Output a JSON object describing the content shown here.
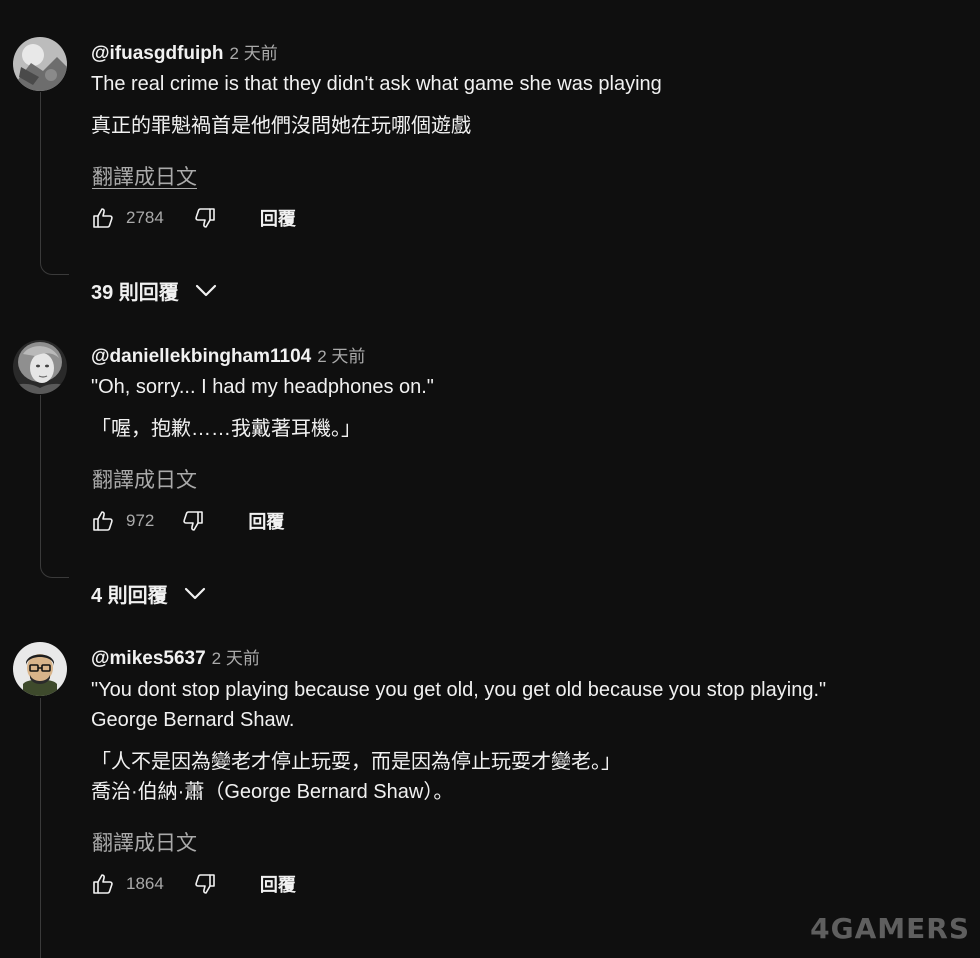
{
  "comments": [
    {
      "handle": "@ifuasgdfuiph",
      "time": "2 天前",
      "text_en": "The real crime is that they didn't  ask what game she was playing",
      "text_zh": "真正的罪魁禍首是他們沒問她在玩哪個遊戲",
      "translate_label": "翻譯成日文",
      "likes": "2784",
      "reply_label": "回覆",
      "replies_label": "39 則回覆"
    },
    {
      "handle": "@daniellekbingham1104",
      "time": "2 天前",
      "text_en": "\"Oh, sorry... I had my headphones on.\"",
      "text_zh": "「喔，抱歉……我戴著耳機。」",
      "translate_label": "翻譯成日文",
      "likes": "972",
      "reply_label": "回覆",
      "replies_label": "4 則回覆"
    },
    {
      "handle": "@mikes5637",
      "time": "2 天前",
      "text_en_line1": "\"You dont stop playing because you get old, you get old because you stop playing.\"",
      "text_en_line2": "George Bernard Shaw.",
      "text_zh_line1": "「人不是因為變老才停止玩耍，而是因為停止玩耍才變老。」",
      "text_zh_line2": "喬治·伯納·蕭（George Bernard Shaw）。",
      "translate_label": "翻譯成日文",
      "likes": "1864",
      "reply_label": "回覆"
    }
  ],
  "watermark": "4GAMERS",
  "icons": {
    "like": "thumbs-up-icon",
    "dislike": "thumbs-down-icon",
    "expand": "chevron-down-icon"
  },
  "colors": {
    "background": "#0f0f0f",
    "primary_text": "#f1f1f1",
    "secondary_text": "#aaaaaa"
  }
}
